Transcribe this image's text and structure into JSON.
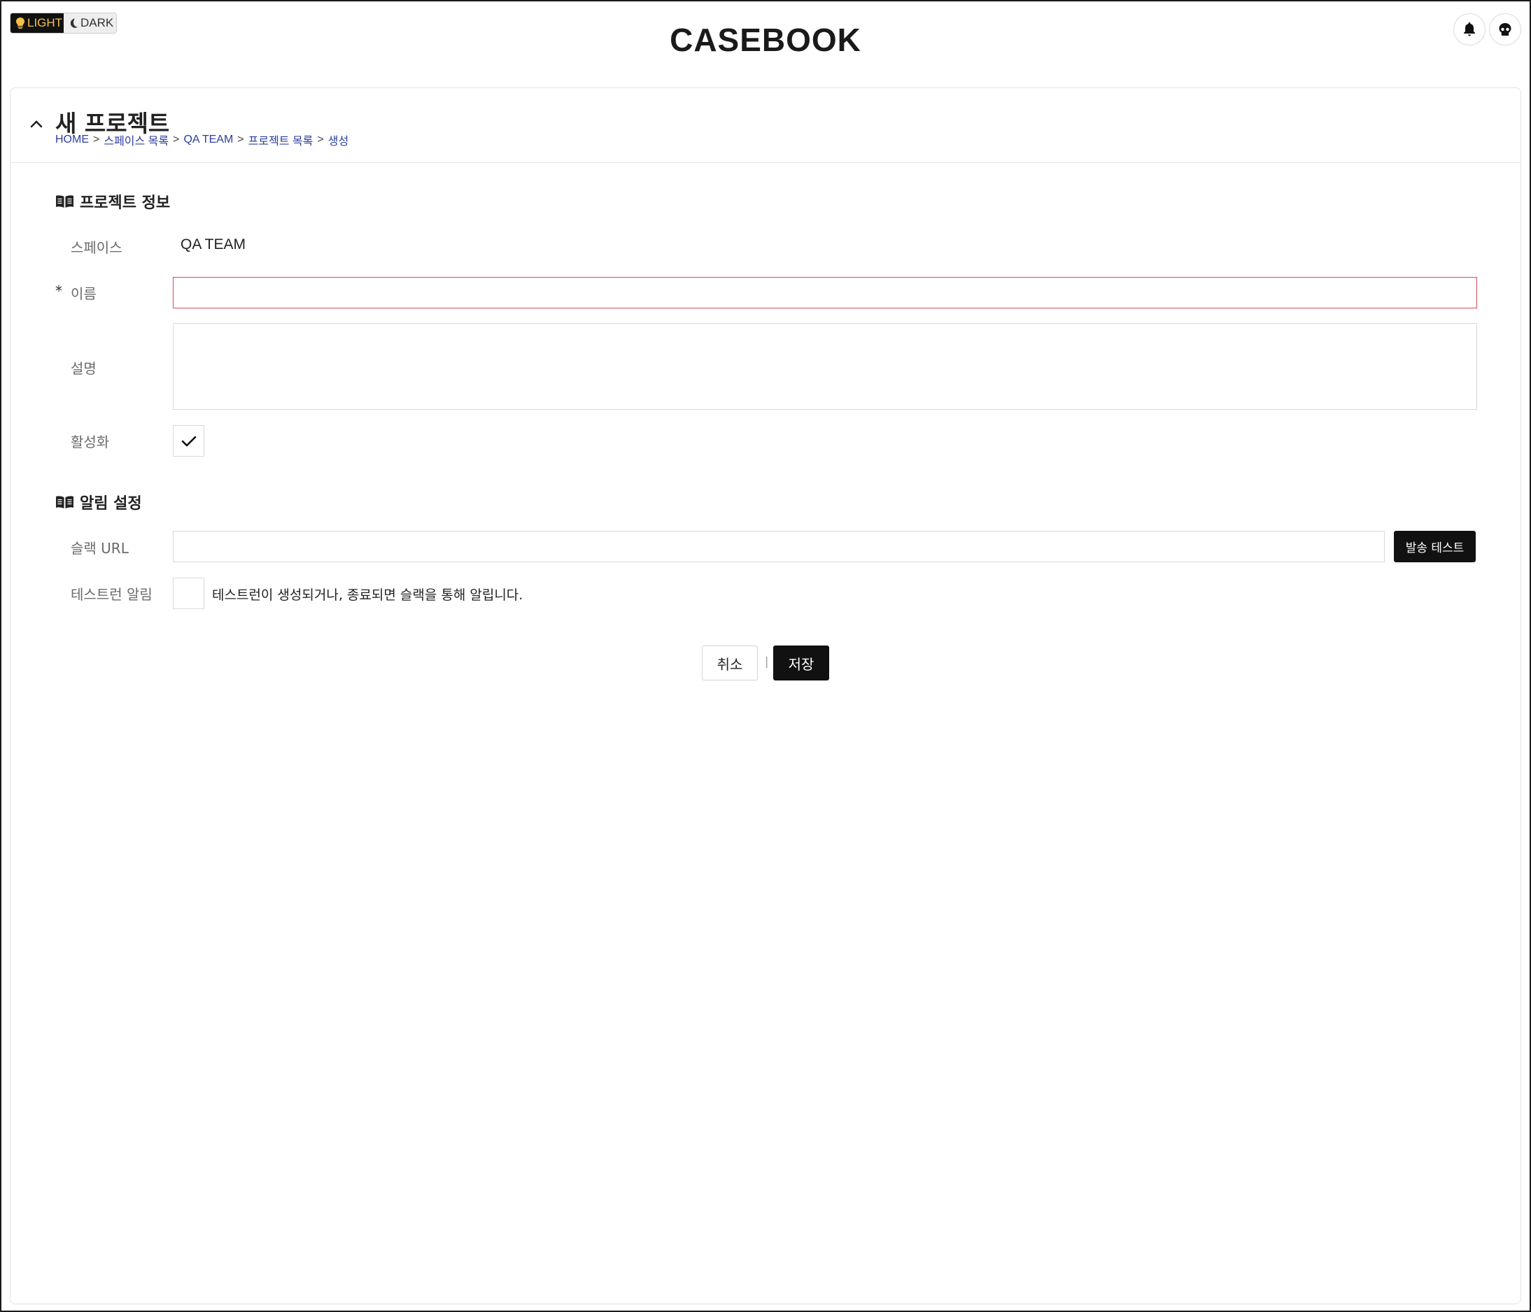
{
  "theme": {
    "light_label": "LIGHT",
    "dark_label": "DARK"
  },
  "header": {
    "logo": "CASEBOOK"
  },
  "page": {
    "title": "새 프로젝트",
    "breadcrumb": [
      "HOME",
      "스페이스 목록",
      "QA TEAM",
      "프로젝트 목록",
      "생성"
    ],
    "breadcrumb_separator": ">"
  },
  "project_info": {
    "section_title": "프로젝트 정보",
    "space_label": "스페이스",
    "space_value": "QA TEAM",
    "required_mark": "*",
    "name_label": "이름",
    "name_value": "",
    "description_label": "설명",
    "description_value": "",
    "active_label": "활성화",
    "active_checked": true
  },
  "notification": {
    "section_title": "알림 설정",
    "slack_label": "슬랙 URL",
    "slack_value": "",
    "send_test_label": "발송 테스트",
    "testrun_label": "테스트런 알림",
    "testrun_checked": false,
    "testrun_description": "테스트런이 생성되거나, 종료되면 슬랙을 통해 알립니다."
  },
  "actions": {
    "cancel_label": "취소",
    "divider": "|",
    "save_label": "저장"
  },
  "colors": {
    "accent_dark": "#111111",
    "light_toggle_text": "#f5c04a",
    "breadcrumb_link": "#2c3e9e",
    "error_border": "#e0485a"
  }
}
